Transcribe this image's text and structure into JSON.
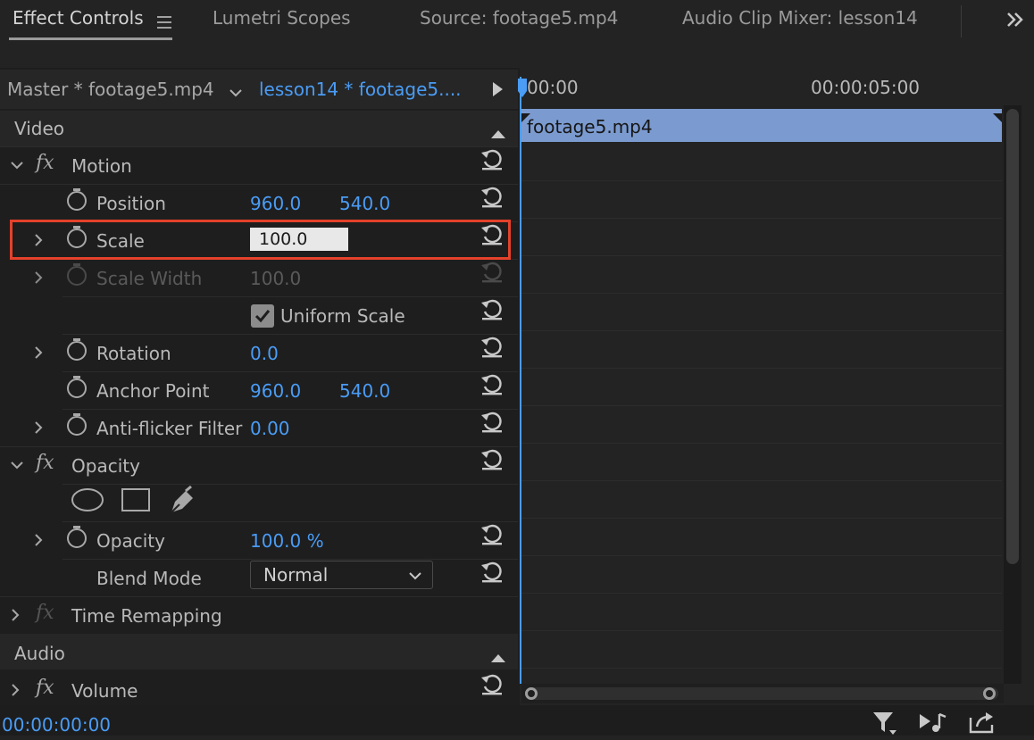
{
  "tabs": [
    {
      "label": "Effect Controls",
      "active": true
    },
    {
      "label": "Lumetri Scopes",
      "active": false
    },
    {
      "label": "Source: footage5.mp4",
      "active": false
    },
    {
      "label": "Audio Clip Mixer: lesson14",
      "active": false
    }
  ],
  "overflow_icon": "double-chevron-right-icon",
  "clip_selector": {
    "master": "Master * footage5.mp4",
    "active": "lesson14 * footage5...."
  },
  "timeline": {
    "ruler_start": "00:00",
    "ruler_mid": "00:00:05:00",
    "clip_name": "footage5.mp4"
  },
  "sections": {
    "video": "Video",
    "audio": "Audio"
  },
  "effects": {
    "motion": {
      "name": "Motion",
      "position": {
        "label": "Position",
        "x": "960.0",
        "y": "540.0"
      },
      "scale": {
        "label": "Scale",
        "value": "100.0"
      },
      "scale_width": {
        "label": "Scale Width",
        "value": "100.0"
      },
      "uniform_scale": {
        "label": "Uniform Scale",
        "checked": true
      },
      "rotation": {
        "label": "Rotation",
        "value": "0.0"
      },
      "anchor_point": {
        "label": "Anchor Point",
        "x": "960.0",
        "y": "540.0"
      },
      "anti_flicker": {
        "label": "Anti-flicker Filter",
        "value": "0.00"
      }
    },
    "opacity": {
      "name": "Opacity",
      "opacity": {
        "label": "Opacity",
        "value": "100.0 %"
      },
      "blend_mode": {
        "label": "Blend Mode",
        "value": "Normal"
      }
    },
    "time_remapping": {
      "name": "Time Remapping"
    },
    "volume": {
      "name": "Volume"
    }
  },
  "fx_label": "fx",
  "timecode": "00:00:00:00",
  "colors": {
    "accent": "#4a9cf5",
    "clip": "#7b9bd0",
    "highlight_box": "#e4412b"
  }
}
